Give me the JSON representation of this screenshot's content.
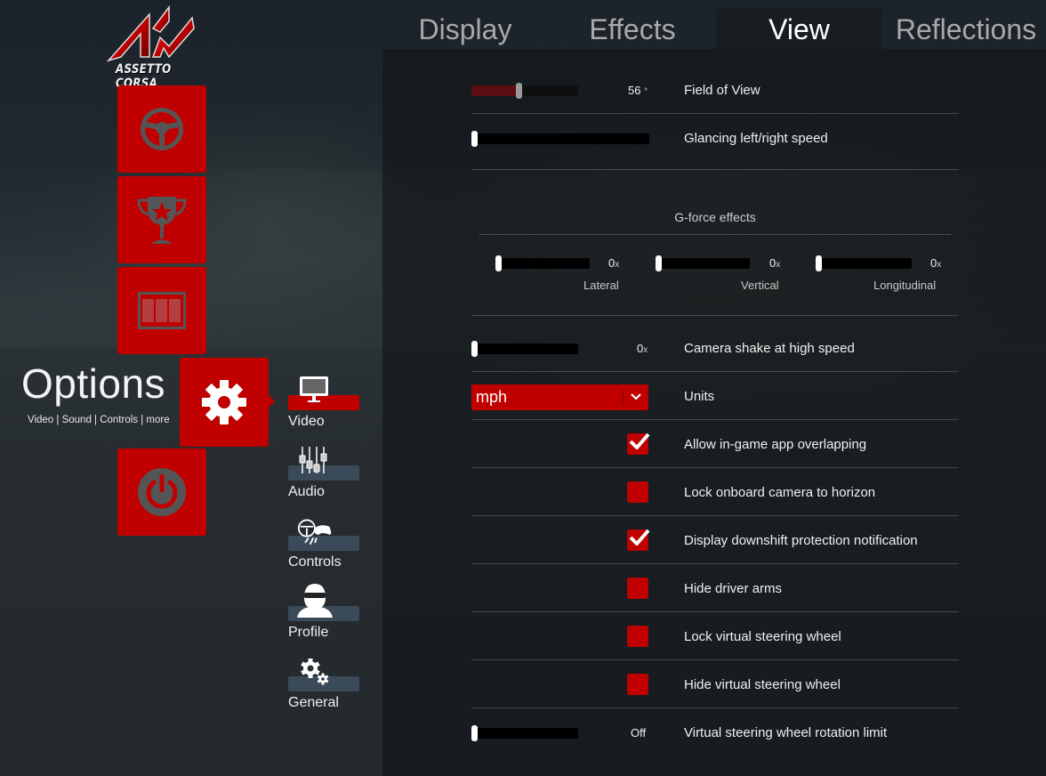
{
  "app": {
    "brand": "ASSETTO CORSA",
    "accent_color": "#c00000"
  },
  "main_nav": {
    "items": [
      {
        "name": "drive",
        "icon": "steering-wheel-icon"
      },
      {
        "name": "events",
        "icon": "trophy-icon"
      },
      {
        "name": "replays",
        "icon": "film-strip-icon"
      },
      {
        "name": "options",
        "icon": "gear-icon",
        "active": true
      },
      {
        "name": "quit",
        "icon": "power-icon"
      }
    ],
    "section_title": "Options",
    "section_subtitle": "Video | Sound | Controls | more"
  },
  "sub_nav": {
    "items": [
      {
        "label": "Video",
        "icon": "monitor-icon",
        "active": true
      },
      {
        "label": "Audio",
        "icon": "mixer-sliders-icon",
        "active": false
      },
      {
        "label": "Controls",
        "icon": "wheel-gamepad-icon",
        "active": false
      },
      {
        "label": "Profile",
        "icon": "driver-helmet-icon",
        "active": false
      },
      {
        "label": "General",
        "icon": "gears-icon",
        "active": false
      }
    ]
  },
  "tabs": [
    {
      "label": "Display",
      "active": false
    },
    {
      "label": "Effects",
      "active": false
    },
    {
      "label": "View",
      "active": true
    },
    {
      "label": "Reflections",
      "active": false
    }
  ],
  "settings": {
    "field_of_view": {
      "label": "Field of View",
      "value": "56",
      "unit": "°",
      "fill_fraction": 0.44
    },
    "glancing_speed": {
      "label": "Glancing left/right speed",
      "fill_fraction": 0.0
    },
    "gforce": {
      "title": "G-force effects",
      "lateral": {
        "label": "Lateral",
        "value": "0",
        "unit": "x",
        "fill_fraction": 0.0
      },
      "vertical": {
        "label": "Vertical",
        "value": "0",
        "unit": "x",
        "fill_fraction": 0.0
      },
      "longitudinal": {
        "label": "Longitudinal",
        "value": "0",
        "unit": "x",
        "fill_fraction": 0.0
      }
    },
    "camera_shake": {
      "label": "Camera shake at high speed",
      "value": "0",
      "unit": "x",
      "fill_fraction": 0.0
    },
    "units": {
      "label": "Units",
      "value": "mph"
    },
    "checkboxes": [
      {
        "label": "Allow in-game app overlapping",
        "checked": true
      },
      {
        "label": "Lock onboard camera to horizon",
        "checked": false
      },
      {
        "label": "Display downshift protection notification",
        "checked": true
      },
      {
        "label": "Hide driver arms",
        "checked": false
      },
      {
        "label": "Lock virtual steering wheel",
        "checked": false
      },
      {
        "label": "Hide virtual steering wheel",
        "checked": false
      }
    ],
    "rotation_limit": {
      "label": "Virtual steering wheel rotation limit",
      "value": "Off",
      "fill_fraction": 0.0
    }
  }
}
